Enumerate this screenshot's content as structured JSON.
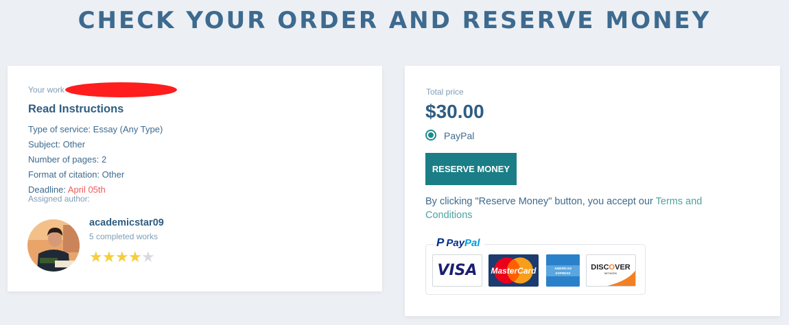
{
  "header": {
    "title": "CHECK YOUR ORDER AND RESERVE MONEY"
  },
  "order": {
    "work_label": "Your work",
    "section_title": "Read Instructions",
    "type_of_service": "Type of service: Essay (Any Type)",
    "subject": "Subject: Other",
    "pages": "Number of pages: 2",
    "citation": "Format of citation: Other",
    "deadline_label": "Deadline: ",
    "deadline_value": "April 05th",
    "assigned_label": "Assigned author:"
  },
  "author": {
    "name": "academicstar09",
    "works": "5 completed works",
    "rating": 4,
    "rating_max": 5
  },
  "payment": {
    "price_label": "Total price",
    "price": "$30.00",
    "method": "PayPal",
    "reserve_button": "RESERVE MONEY",
    "terms_prefix": "By clicking \"Reserve Money\" button, you accept our ",
    "terms_link": "Terms and Conditions",
    "paypal_logo_pay": "Pay",
    "paypal_logo_pal": "Pal",
    "cards": [
      "VISA",
      "MasterCard",
      "AMERICAN EXPRESS",
      "DISCOVER NETWORK"
    ],
    "icons": [
      "paypal-icon",
      "visa-icon",
      "mastercard-icon",
      "amex-icon",
      "discover-icon"
    ]
  },
  "colors": {
    "accent": "#1b7e86",
    "title": "#3d6a8f",
    "deadline": "#f05a5a",
    "link": "#4aa3a0",
    "star": "#f5cd3d"
  }
}
